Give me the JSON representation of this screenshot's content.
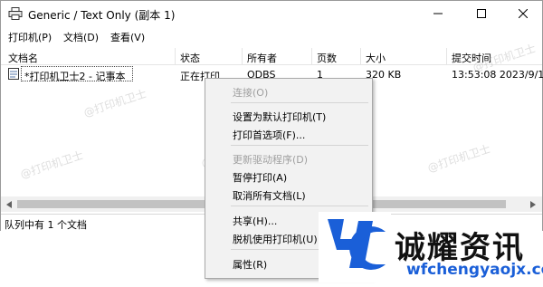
{
  "window": {
    "title": "Generic / Text Only (副本 1)"
  },
  "menubar": {
    "items": [
      "打印机(P)",
      "文档(D)",
      "查看(V)"
    ]
  },
  "columns": [
    "文档名",
    "状态",
    "所有者",
    "页数",
    "大小",
    "提交时间"
  ],
  "jobs": [
    {
      "doc_name": "*打印机卫士2 - 记事本",
      "status": "正在打印",
      "owner": "ODBS",
      "pages": "1",
      "size": "320 KB",
      "submitted": "13:53:08  2023/9/1"
    }
  ],
  "statusbar": {
    "text": "队列中有 1 个文档"
  },
  "context_menu": {
    "items": [
      {
        "label": "连接(O)",
        "enabled": false
      },
      {
        "label": "设置为默认打印机(T)",
        "enabled": true
      },
      {
        "label": "打印首选项(F)...",
        "enabled": true
      },
      {
        "label": "更新驱动程序(D)",
        "enabled": false
      },
      {
        "label": "暂停打印(A)",
        "enabled": true
      },
      {
        "label": "取消所有文档(L)",
        "enabled": true
      },
      {
        "label": "共享(H)...",
        "enabled": true
      },
      {
        "label": "脱机使用打印机(U)",
        "enabled": true
      },
      {
        "label": "属性(R)",
        "enabled": true
      }
    ]
  },
  "watermark": {
    "text": "@打印机卫士"
  },
  "branding": {
    "name": "诚耀资讯",
    "url": "wfchengyaojx.com",
    "color": "#1a5fd8"
  },
  "icons": [
    "printer-icon",
    "minimize-icon",
    "maximize-icon",
    "close-icon",
    "document-icon",
    "scroll-left-icon",
    "scroll-right-icon"
  ]
}
